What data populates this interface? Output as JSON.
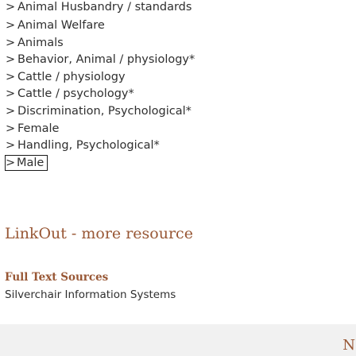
{
  "mesh_terms": {
    "chevron": ">",
    "items": [
      "Animal Husbandry / standards",
      "Animal Welfare",
      "Animals",
      "Behavior, Animal / physiology*",
      "Cattle / physiology",
      "Cattle / psychology*",
      "Discrimination, Psychological*",
      "Female",
      "Handling, Psychological*",
      "Male"
    ]
  },
  "linkout": {
    "title": "LinkOut - more resource",
    "full_text_heading": "Full Text Sources",
    "full_text_link": "Silverchair Information Systems"
  },
  "bottom_band": {
    "partial_text": "N("
  }
}
